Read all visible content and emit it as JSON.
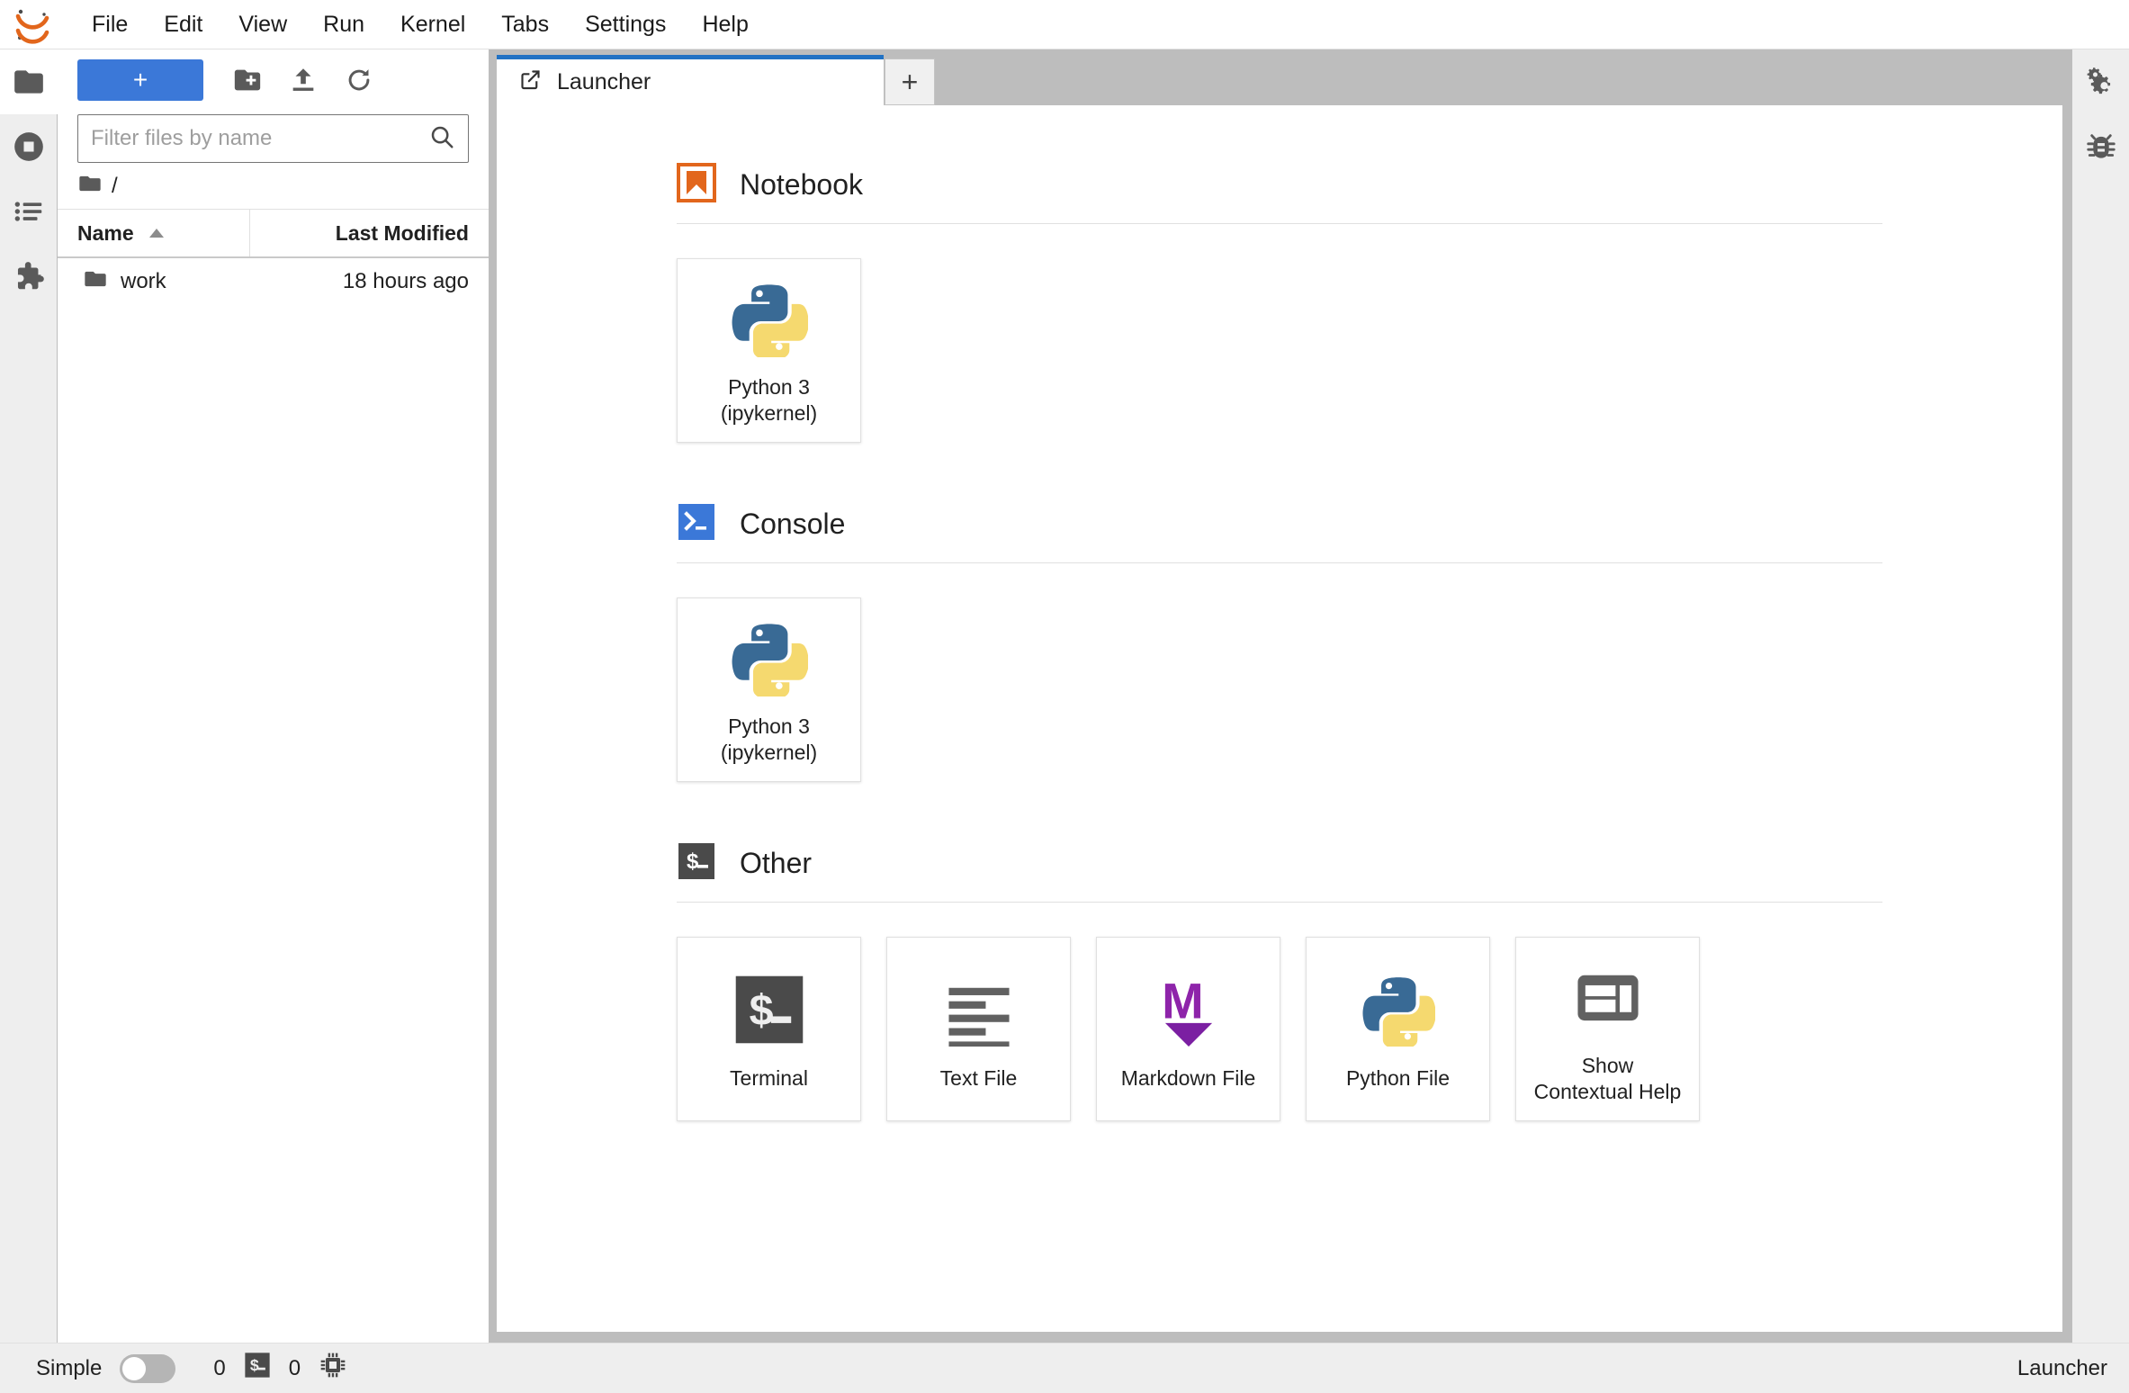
{
  "app": {
    "logo_icon": "jupyter-logo",
    "menus": [
      "File",
      "Edit",
      "View",
      "Run",
      "Kernel",
      "Tabs",
      "Settings",
      "Help"
    ]
  },
  "left_rail": {
    "items": [
      {
        "name": "file-browser",
        "icon": "folder-icon",
        "active": true
      },
      {
        "name": "running-sessions",
        "icon": "stop-circle-icon",
        "active": false
      },
      {
        "name": "commands",
        "icon": "list-icon",
        "active": false
      },
      {
        "name": "extension-manager",
        "icon": "puzzle-icon",
        "active": false
      }
    ]
  },
  "right_rail": {
    "items": [
      {
        "name": "property-inspector",
        "icon": "gears-icon"
      },
      {
        "name": "debugger",
        "icon": "bug-icon"
      }
    ]
  },
  "file_browser": {
    "toolbar": {
      "new_launcher_label": "+",
      "new_folder_icon": "new-folder-icon",
      "upload_icon": "upload-icon",
      "refresh_icon": "refresh-icon"
    },
    "filter": {
      "placeholder": "Filter files by name",
      "value": "",
      "icon": "search-icon"
    },
    "breadcrumb": {
      "icon": "folder-icon",
      "path": "/"
    },
    "columns": {
      "name": "Name",
      "last_modified": "Last Modified",
      "sort": "ascending"
    },
    "rows": [
      {
        "icon": "folder-icon",
        "name": "work",
        "last_modified": "18 hours ago"
      }
    ]
  },
  "dock": {
    "tabs": [
      {
        "label": "Launcher",
        "icon": "launcher-icon",
        "active": true
      }
    ],
    "add_tab_label": "+"
  },
  "launcher": {
    "sections": [
      {
        "id": "notebook",
        "title": "Notebook",
        "icon": "notebook-bookmark-icon",
        "cards": [
          {
            "label": "Python 3\n(ipykernel)",
            "line1": "Python 3",
            "line2": "(ipykernel)",
            "icon": "python-logo-icon"
          }
        ]
      },
      {
        "id": "console",
        "title": "Console",
        "icon": "console-prompt-icon",
        "cards": [
          {
            "label": "Python 3\n(ipykernel)",
            "line1": "Python 3",
            "line2": "(ipykernel)",
            "icon": "python-logo-icon"
          }
        ]
      },
      {
        "id": "other",
        "title": "Other",
        "icon": "terminal-dollar-icon",
        "cards": [
          {
            "label": "Terminal",
            "line1": "Terminal",
            "line2": "",
            "icon": "terminal-dollar-icon"
          },
          {
            "label": "Text File",
            "line1": "Text File",
            "line2": "",
            "icon": "text-file-icon"
          },
          {
            "label": "Markdown File",
            "line1": "Markdown File",
            "line2": "",
            "icon": "markdown-icon"
          },
          {
            "label": "Python File",
            "line1": "Python File",
            "line2": "",
            "icon": "python-logo-icon"
          },
          {
            "label": "Show Contextual Help",
            "line1": "Show",
            "line2": "Contextual Help",
            "icon": "inspector-icon"
          }
        ]
      }
    ]
  },
  "status_bar": {
    "simple_label": "Simple",
    "simple_enabled": false,
    "kernel_count": "0",
    "terminal_icon": "terminal-dollar-icon",
    "terminal_count": "0",
    "kernel_icon": "cpu-chip-icon",
    "active_document": "Launcher"
  },
  "colors": {
    "accent_blue": "#3b78d8",
    "tab_active_border": "#2272c4",
    "notebook_orange": "#E2661C",
    "console_blue": "#3B78D8",
    "terminal_dark": "#4A4A4A",
    "markdown_purple": "#8E24AA",
    "python_blue": "#396A95",
    "python_yellow": "#F5D96F",
    "dock_background": "#BDBDBD",
    "panel_background": "#EEEEEE"
  }
}
